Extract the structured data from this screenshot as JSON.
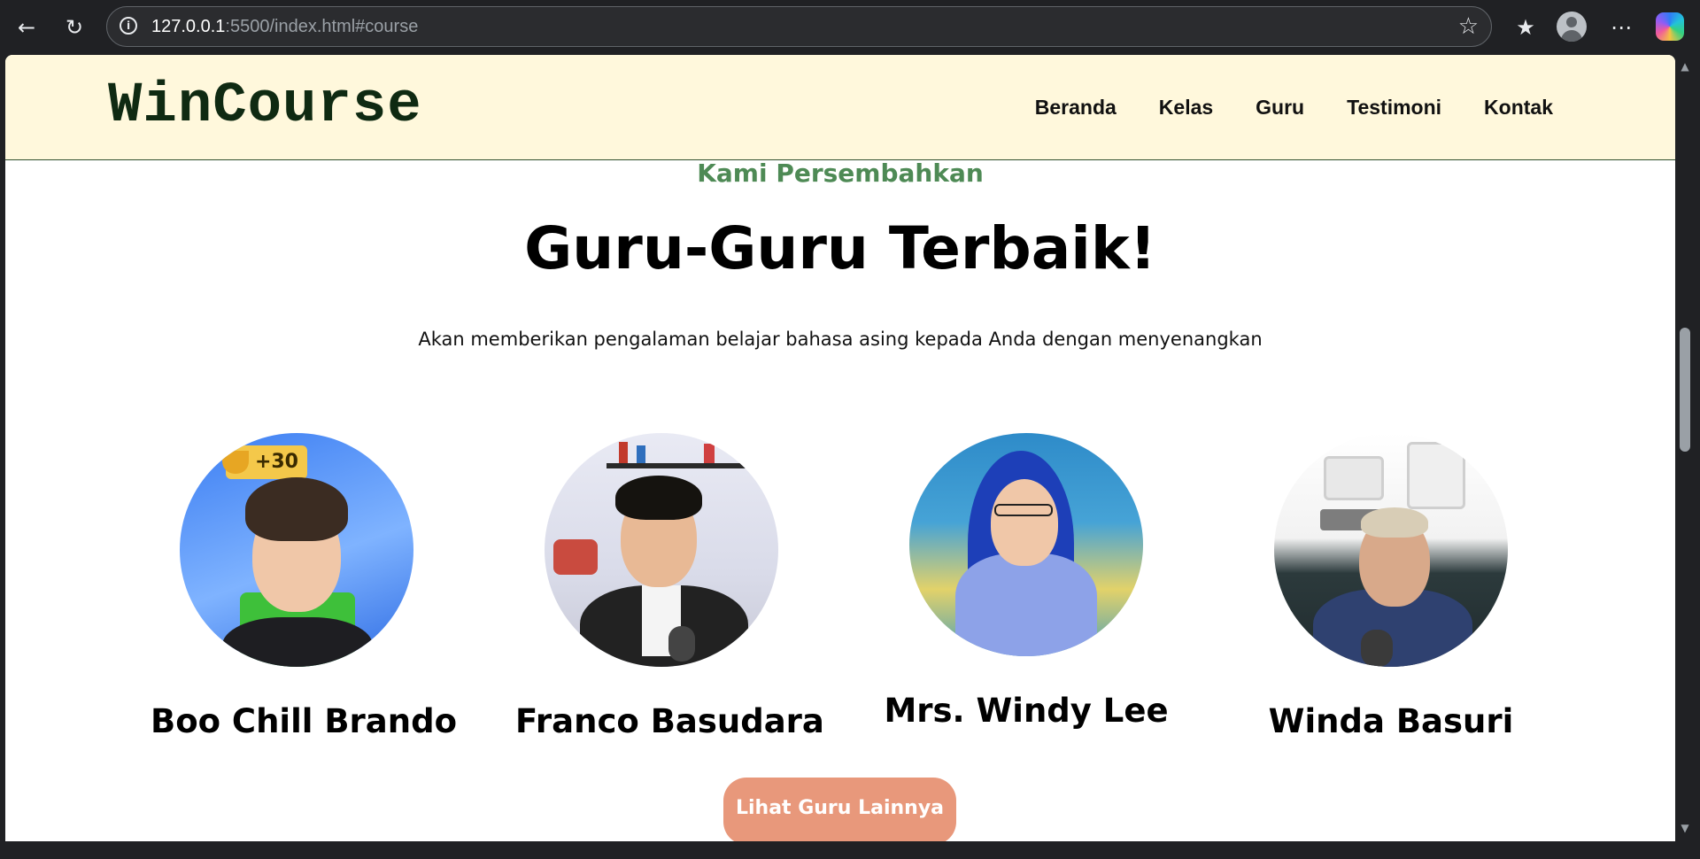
{
  "browser": {
    "url_host": "127.0.0.1",
    "url_path": ":5500/index.html#course"
  },
  "site": {
    "logo": "WinCourse",
    "menu": [
      "Beranda",
      "Kelas",
      "Guru",
      "Testimoni",
      "Kontak"
    ]
  },
  "section": {
    "kicker": "Kami Persembahkan",
    "headline": "Guru-Guru Terbaik!",
    "subtitle": "Akan memberikan pengalaman belajar bahasa asing kepada Anda dengan menyenangkan",
    "badge": "+30",
    "teachers": [
      {
        "name": "Boo Chill Brando"
      },
      {
        "name": "Franco Basudara"
      },
      {
        "name": "Mrs. Windy Lee"
      },
      {
        "name": "Winda Basuri"
      }
    ],
    "cta_label": "Lihat Guru Lainnya"
  },
  "colors": {
    "nav_bg": "#fff8dc",
    "kicker": "#4e8a55",
    "cta": "#e8987b"
  }
}
